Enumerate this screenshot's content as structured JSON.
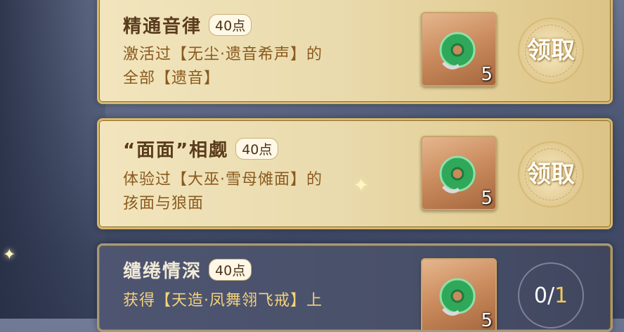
{
  "tasks": [
    {
      "title": "精通音律",
      "points": "40点",
      "desc_line1": "激活过【无尘·遗音希声】的",
      "desc_line2": "全部【遗音】",
      "reward_qty": "5",
      "action": "领取"
    },
    {
      "title": "“面面”相觑",
      "points": "40点",
      "desc_line1": "体验过【大巫·雪母傩面】的",
      "desc_line2": "孩面与狼面",
      "reward_qty": "5",
      "action": "领取"
    },
    {
      "title": "缱绻情深",
      "points": "40点",
      "desc_line1": "获得【天造·凤舞翎飞戒】上",
      "desc_line2": "",
      "reward_qty": "5",
      "progress_current": "0",
      "progress_sep": "/",
      "progress_goal": "1"
    }
  ],
  "icons": {
    "reward": "jade-disc-icon"
  },
  "colors": {
    "gold_card": "#eadbae",
    "title_brown": "#5a3b1d",
    "desc_brown": "#8a5a1e",
    "border_gold": "#d8b86a",
    "progress_goal": "#f3c95c"
  }
}
